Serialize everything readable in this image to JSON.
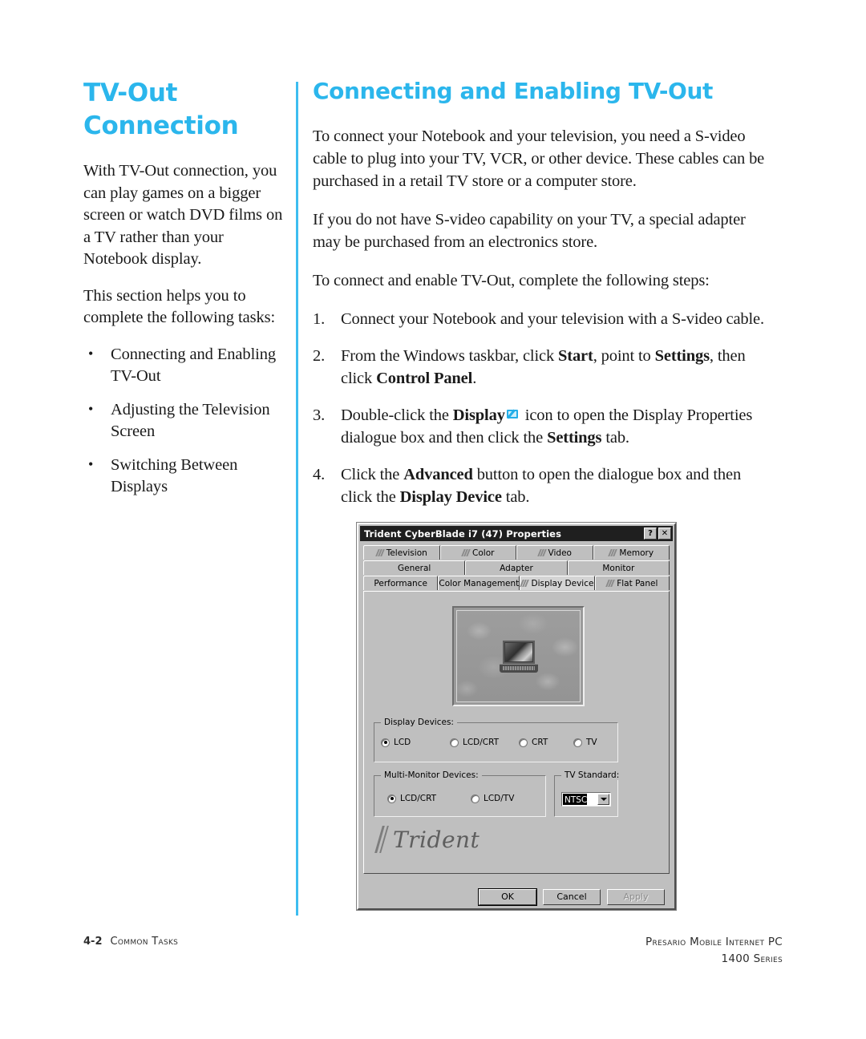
{
  "sidebar": {
    "title_lines": [
      "TV-Out",
      "Connection"
    ],
    "paragraphs": [
      "With TV-Out connection, you can play games on a bigger screen or watch DVD films on a TV rather than your Notebook display.",
      "This section helps you to complete the following tasks:"
    ],
    "bullets": [
      "Connecting and Enabling TV-Out",
      "Adjusting the Television Screen",
      "Switching Between Displays"
    ],
    "bullet_glyph": "•"
  },
  "main": {
    "title": "Connecting and Enabling TV-Out",
    "paragraphs": [
      "To connect your Notebook and your television, you need a S-video cable to plug into your TV, VCR, or other device. These cables can be purchased in a retail TV store or a computer store.",
      "If you do not have S-video capability on your TV, a special adapter may be purchased from an electronics store.",
      "To connect and enable TV-Out, complete the following steps:"
    ],
    "steps": [
      {
        "num": "1.",
        "parts": [
          {
            "t": "Connect your Notebook and your television with a S-video cable.",
            "b": false
          }
        ]
      },
      {
        "num": "2.",
        "parts": [
          {
            "t": "From the Windows taskbar, click ",
            "b": false
          },
          {
            "t": "Start",
            "b": true
          },
          {
            "t": ", point to ",
            "b": false
          },
          {
            "t": "Settings",
            "b": true
          },
          {
            "t": ", then click ",
            "b": false
          },
          {
            "t": "Control Panel",
            "b": true
          },
          {
            "t": ".",
            "b": false
          }
        ]
      },
      {
        "num": "3.",
        "parts": [
          {
            "t": "Double-click the ",
            "b": false
          },
          {
            "t": "Display",
            "b": true
          },
          {
            "t": "ICON",
            "b": false
          },
          {
            "t": " icon to open the Display Properties dialogue box and then click the ",
            "b": false
          },
          {
            "t": "Settings",
            "b": true
          },
          {
            "t": " tab.",
            "b": false
          }
        ]
      },
      {
        "num": "4.",
        "parts": [
          {
            "t": "Click the ",
            "b": false
          },
          {
            "t": "Advanced",
            "b": true
          },
          {
            "t": " button to open the dialogue box and then click the ",
            "b": false
          },
          {
            "t": "Display Device",
            "b": true
          },
          {
            "t": " tab.",
            "b": false
          }
        ]
      }
    ]
  },
  "dialog": {
    "title": "Trident CyberBlade i7 (47) Properties",
    "titlebar_buttons": [
      {
        "name": "help-button",
        "label": "?"
      },
      {
        "name": "close-button",
        "label": "✕"
      }
    ],
    "tab_rows": [
      [
        {
          "label": "Television",
          "mark": true,
          "active": false
        },
        {
          "label": "Color",
          "mark": true,
          "active": false
        },
        {
          "label": "Video",
          "mark": true,
          "active": false
        },
        {
          "label": "Memory",
          "mark": true,
          "active": false
        }
      ],
      [
        {
          "label": "General",
          "mark": false,
          "active": false
        },
        {
          "label": "Adapter",
          "mark": false,
          "active": false
        },
        {
          "label": "Monitor",
          "mark": false,
          "active": false
        }
      ],
      [
        {
          "label": "Performance",
          "mark": false,
          "active": false
        },
        {
          "label": "Color Management",
          "mark": false,
          "active": false
        },
        {
          "label": "Display Device",
          "mark": true,
          "active": true
        },
        {
          "label": "Flat Panel",
          "mark": true,
          "active": false
        }
      ]
    ],
    "preview_alt": "desktop preview with notebook on patterned wallpaper",
    "groups": {
      "display_devices": {
        "label": "Display Devices:",
        "options": [
          {
            "label": "LCD",
            "selected": true
          },
          {
            "label": "LCD/CRT",
            "selected": false
          },
          {
            "label": "CRT",
            "selected": false
          },
          {
            "label": "TV",
            "selected": false
          }
        ]
      },
      "multi_monitor": {
        "label": "Multi-Monitor Devices:",
        "options": [
          {
            "label": "LCD/CRT",
            "selected": true
          },
          {
            "label": "LCD/TV",
            "selected": false
          }
        ]
      },
      "tv_standard": {
        "label": "TV Standard:",
        "value": "NTSC"
      }
    },
    "brand": "Trident",
    "buttons": [
      {
        "label": "OK",
        "state": "default"
      },
      {
        "label": "Cancel",
        "state": "normal"
      },
      {
        "label": "Apply",
        "state": "disabled"
      }
    ]
  },
  "footer": {
    "page_number": "4-2",
    "section": "Common Tasks",
    "product": "Presario Mobile Internet PC",
    "series": "1400 Series"
  },
  "colors": {
    "accent": "#2BB6EC",
    "divider": "#3DBDF0",
    "dialog_face": "#BFBFBF",
    "titlebar": "#1F1F1F"
  }
}
